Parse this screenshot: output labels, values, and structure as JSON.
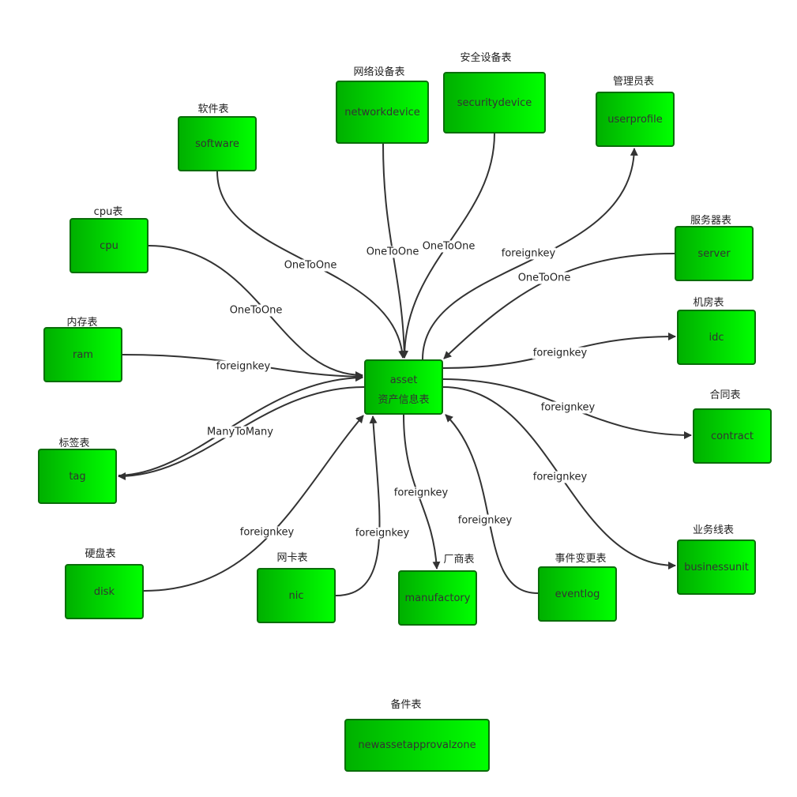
{
  "nodes": {
    "asset": {
      "name": "asset",
      "caption": "资产信息表"
    },
    "software": {
      "name": "software",
      "caption": "软件表"
    },
    "networkdevice": {
      "name": "networkdevice",
      "caption": "网络设备表"
    },
    "securitydevice": {
      "name": "securitydevice",
      "caption": "安全设备表"
    },
    "userprofile": {
      "name": "userprofile",
      "caption": "管理员表"
    },
    "cpu": {
      "name": "cpu",
      "caption": "cpu表"
    },
    "server": {
      "name": "server",
      "caption": "服务器表"
    },
    "idc": {
      "name": "idc",
      "caption": "机房表"
    },
    "ram": {
      "name": "ram",
      "caption": "内存表"
    },
    "contract": {
      "name": "contract",
      "caption": "合同表"
    },
    "tag": {
      "name": "tag",
      "caption": "标签表"
    },
    "businessunit": {
      "name": "businessunit",
      "caption": "业务线表"
    },
    "disk": {
      "name": "disk",
      "caption": "硬盘表"
    },
    "nic": {
      "name": "nic",
      "caption": "网卡表"
    },
    "manufactory": {
      "name": "manufactory",
      "caption": "厂商表"
    },
    "eventlog": {
      "name": "eventlog",
      "caption": "事件变更表"
    },
    "newassetapprovalzone": {
      "name": "newassetapprovalzone",
      "caption": "备件表"
    }
  },
  "edges": [
    {
      "from": "software",
      "to": "asset",
      "label": "OneToOne"
    },
    {
      "from": "networkdevice",
      "to": "asset",
      "label": "OneToOne"
    },
    {
      "from": "securitydevice",
      "to": "asset",
      "label": "OneToOne"
    },
    {
      "from": "asset",
      "to": "userprofile",
      "label": "foreignkey"
    },
    {
      "from": "server",
      "to": "asset",
      "label": "OneToOne"
    },
    {
      "from": "cpu",
      "to": "asset",
      "label": "OneToOne"
    },
    {
      "from": "asset",
      "to": "idc",
      "label": "foreignkey"
    },
    {
      "from": "ram",
      "to": "asset",
      "label": "foreignkey"
    },
    {
      "from": "asset",
      "to": "contract",
      "label": "foreignkey"
    },
    {
      "from": "asset",
      "to": "tag",
      "label": "ManyToMany"
    },
    {
      "from": "asset",
      "to": "businessunit",
      "label": "foreignkey"
    },
    {
      "from": "disk",
      "to": "asset",
      "label": "foreignkey"
    },
    {
      "from": "nic",
      "to": "asset",
      "label": "foreignkey"
    },
    {
      "from": "asset",
      "to": "manufactory",
      "label": "foreignkey"
    },
    {
      "from": "eventlog",
      "to": "asset",
      "label": "foreignkey"
    }
  ],
  "colors": {
    "node_gradient_start": "#00b000",
    "node_gradient_end": "#00ff00",
    "node_border": "#0a6e0a",
    "edge": "#333333"
  }
}
